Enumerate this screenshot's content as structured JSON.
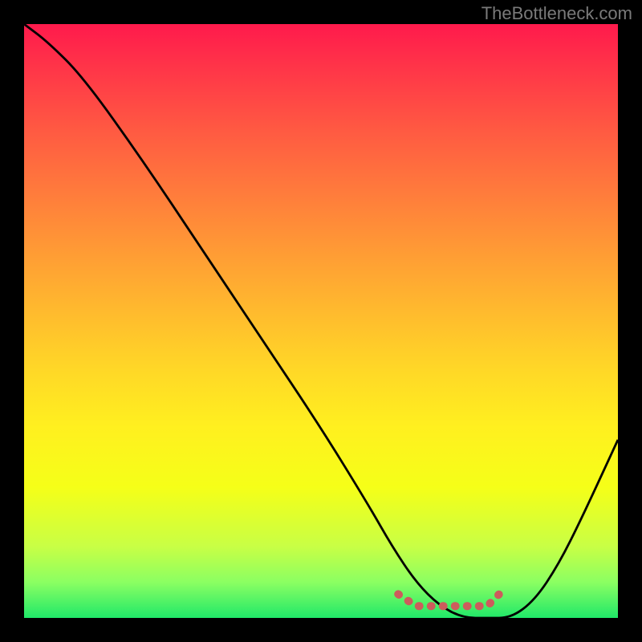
{
  "watermark": "TheBottleneck.com",
  "chart_data": {
    "type": "line",
    "title": "",
    "xlabel": "",
    "ylabel": "",
    "xlim": [
      0,
      100
    ],
    "ylim": [
      0,
      100
    ],
    "grid": false,
    "legend": false,
    "series": [
      {
        "name": "bottleneck-curve",
        "color": "#000000",
        "x": [
          0,
          4,
          10,
          20,
          30,
          40,
          50,
          58,
          62,
          66,
          70,
          74,
          78,
          82,
          86,
          90,
          94,
          100
        ],
        "y": [
          100,
          97,
          91,
          77,
          62,
          47,
          32,
          19,
          12,
          6,
          2,
          0,
          0,
          0,
          3,
          9,
          17,
          30
        ]
      },
      {
        "name": "optimal-region-marker",
        "color": "#cd5c5c",
        "x": [
          63,
          66,
          70,
          74,
          78,
          80
        ],
        "y": [
          4,
          2,
          2,
          2,
          2,
          4
        ]
      }
    ]
  },
  "colors": {
    "background": "#000000",
    "watermark_text": "#7a7a7a",
    "curve_stroke": "#000000",
    "marker_stroke": "#cd5c5c",
    "gradient_top": "#ff1a4c",
    "gradient_bottom": "#20e869"
  }
}
